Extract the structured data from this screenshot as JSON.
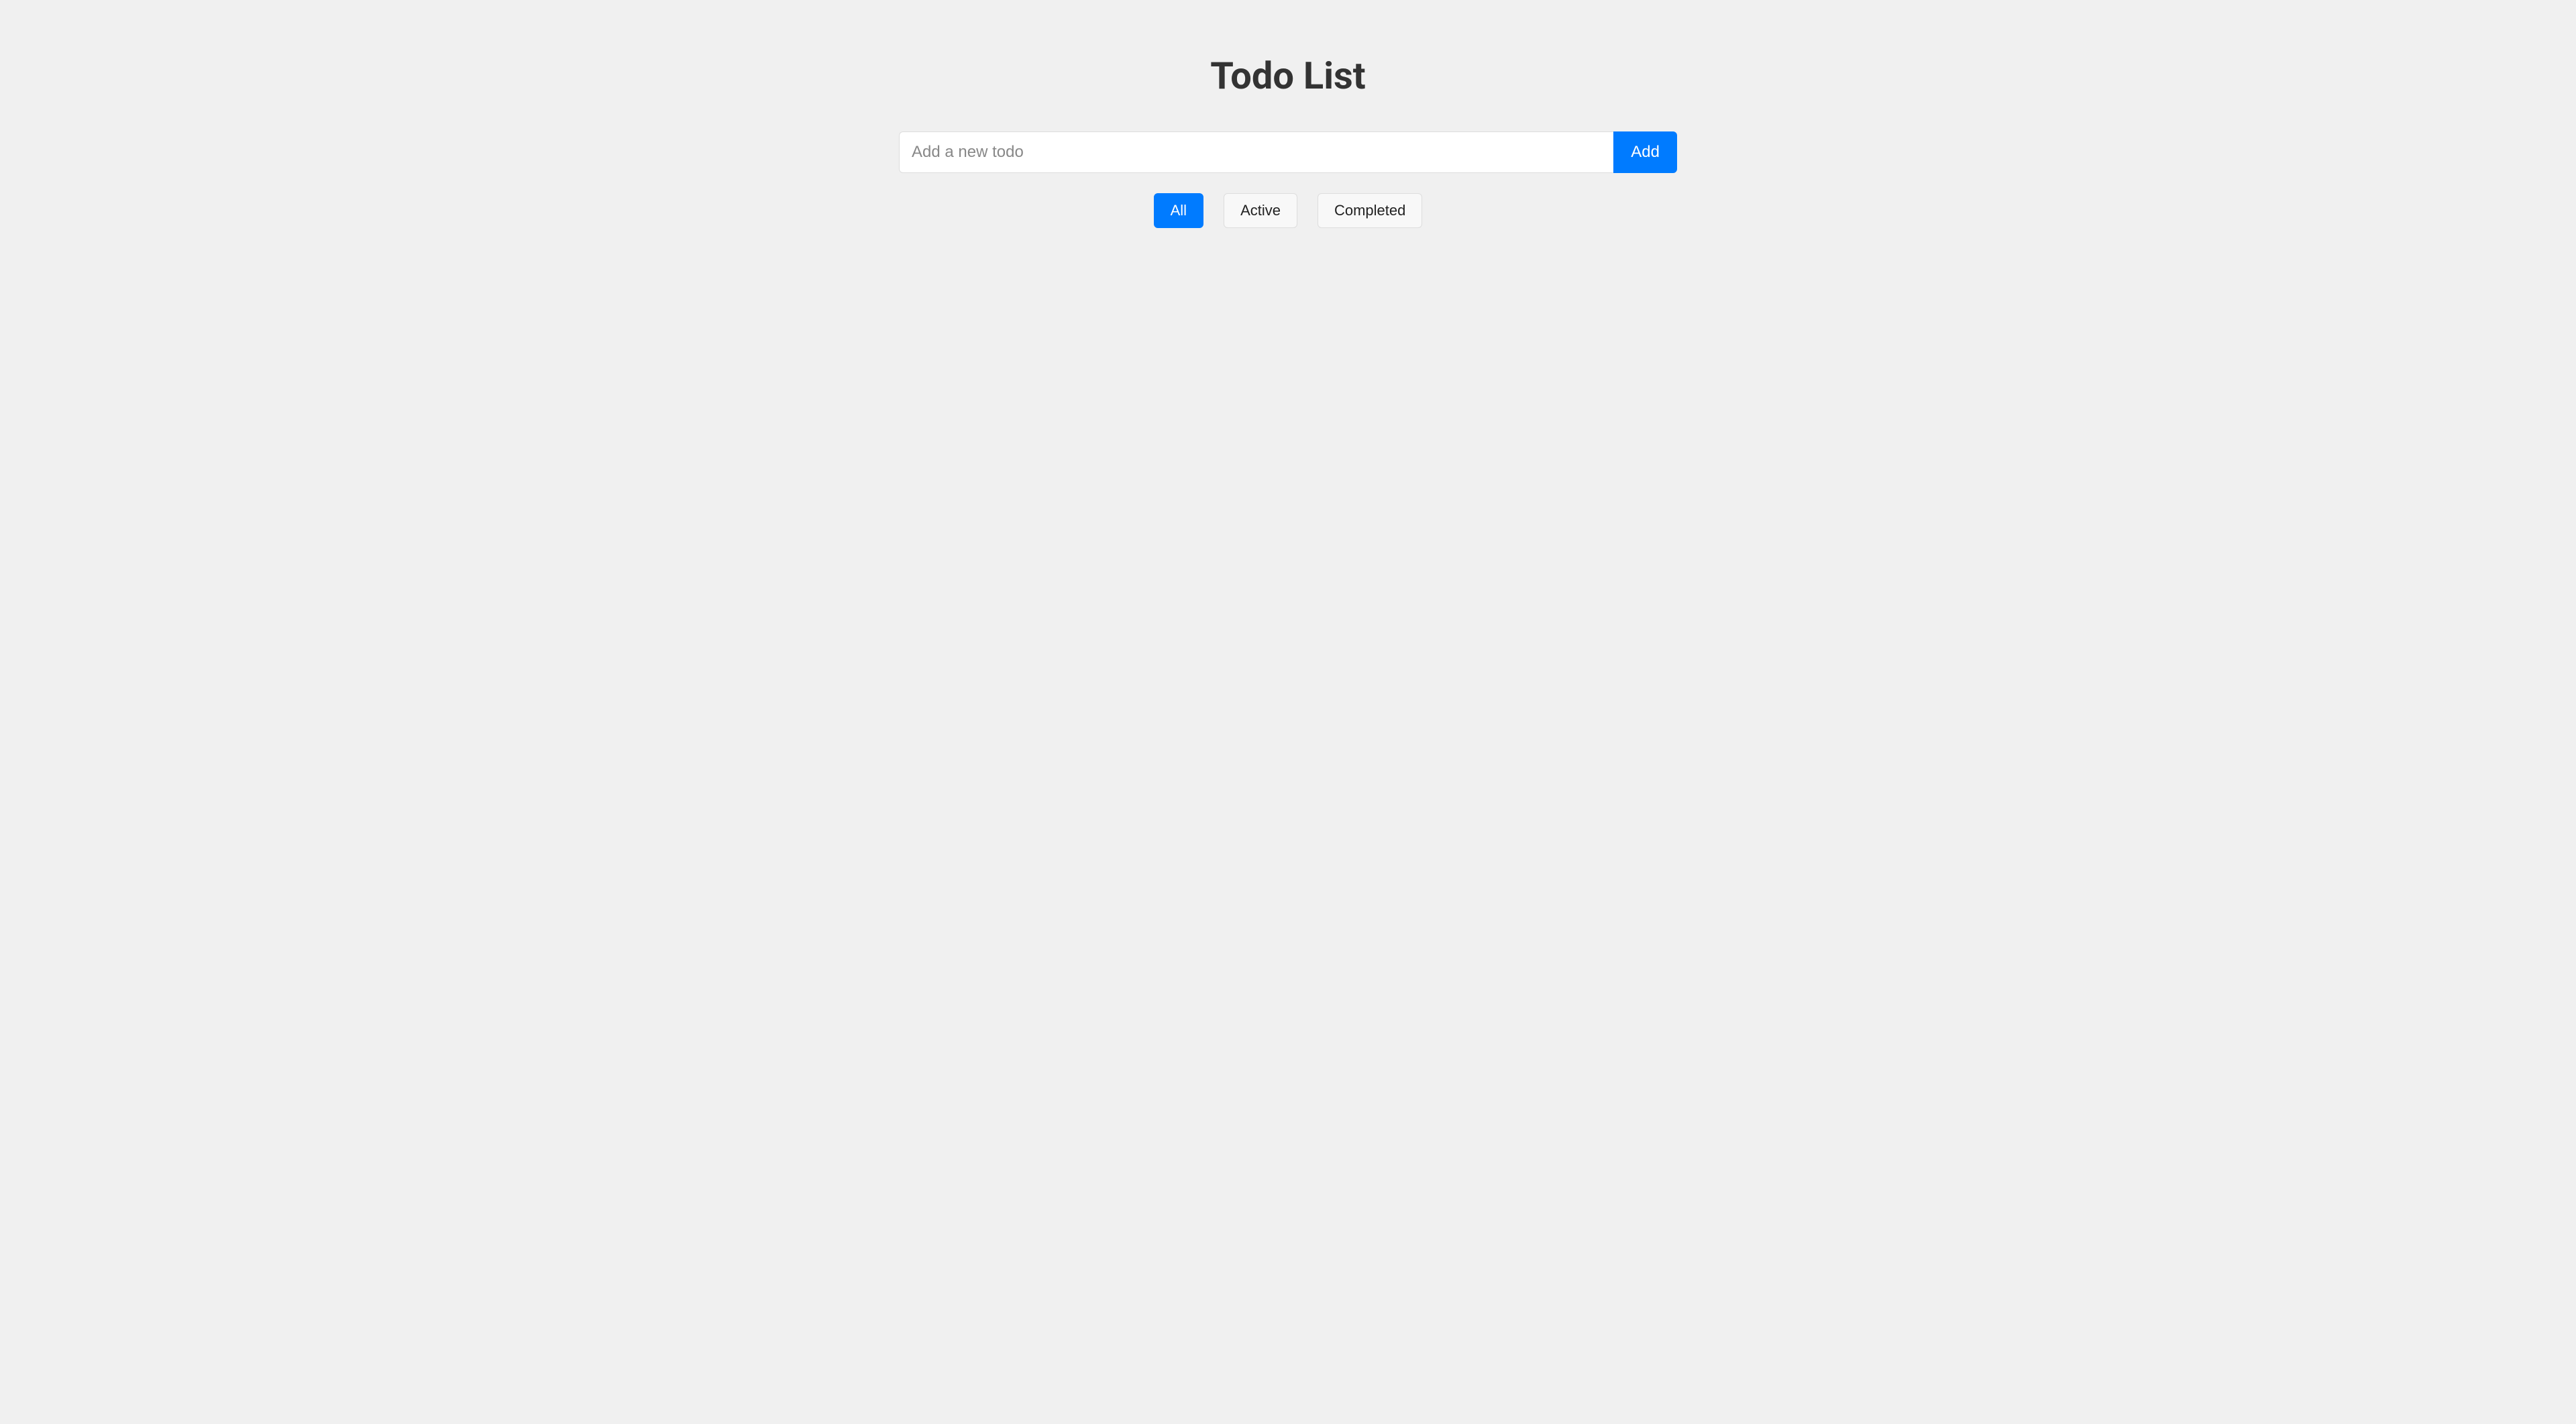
{
  "header": {
    "title": "Todo List"
  },
  "input": {
    "placeholder": "Add a new todo",
    "value": "",
    "add_label": "Add"
  },
  "filters": {
    "all_label": "All",
    "active_label": "Active",
    "completed_label": "Completed",
    "selected": "all"
  }
}
